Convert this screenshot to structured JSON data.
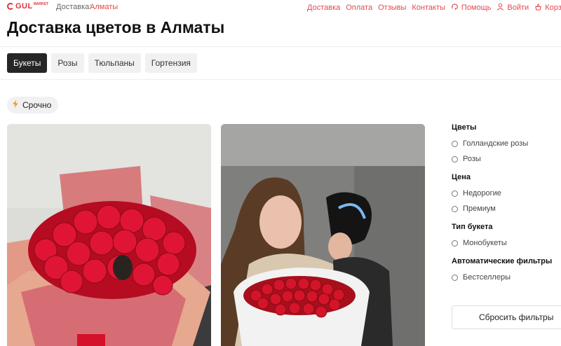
{
  "header": {
    "logo_text": "GUL",
    "logo_sup": "MARKET",
    "delivery_label": "Доставка:",
    "city": "Алматы",
    "nav": [
      {
        "label": "Доставка"
      },
      {
        "label": "Оплата"
      },
      {
        "label": "Отзывы"
      },
      {
        "label": "Контакты"
      },
      {
        "label": "Помощь",
        "icon": "help-icon"
      },
      {
        "label": "Войти",
        "icon": "user-icon"
      },
      {
        "label": "Корзина (",
        "icon": "cart-icon"
      }
    ]
  },
  "page_title": "Доставка цветов в Алматы",
  "tabs": [
    {
      "label": "Букеты",
      "active": true
    },
    {
      "label": "Розы",
      "active": false
    },
    {
      "label": "Тюльпаны",
      "active": false
    },
    {
      "label": "Гортензия",
      "active": false
    }
  ],
  "urgent_chip": "Срочно",
  "filters": {
    "groups": [
      {
        "title": "Цветы",
        "options": [
          "Голландские розы",
          "Розы"
        ]
      },
      {
        "title": "Цена",
        "options": [
          "Недорогие",
          "Премиум"
        ]
      },
      {
        "title": "Тип букета",
        "options": [
          "Монобукеты"
        ]
      },
      {
        "title": "Автоматические фильтры",
        "options": [
          "Бестселлеры"
        ]
      }
    ],
    "reset_label": "Сбросить фильтры"
  },
  "colors": {
    "accent": "#e5484d",
    "active_tab": "#262626",
    "rose": "#d4102a"
  }
}
